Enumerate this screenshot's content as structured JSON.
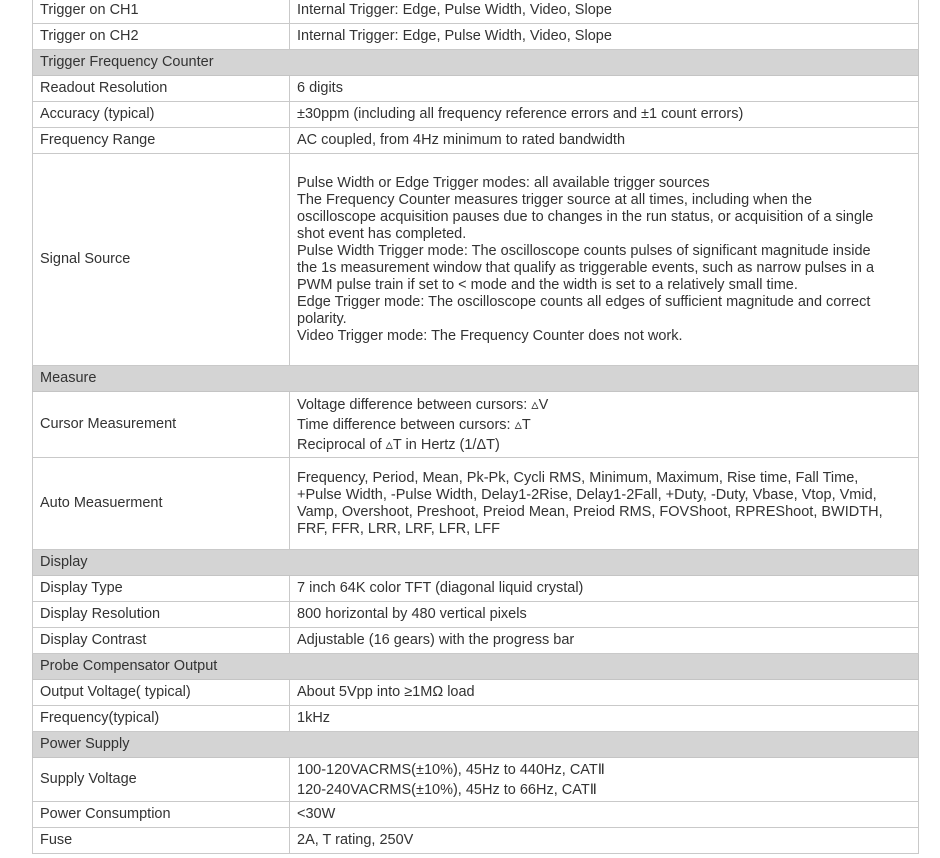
{
  "rows": [
    {
      "type": "row",
      "label": "Trigger on CH1",
      "value": [
        "Internal Trigger: Edge, Pulse Width, Video, Slope"
      ]
    },
    {
      "type": "row",
      "label": "Trigger on CH2",
      "value": [
        "Internal Trigger: Edge, Pulse Width, Video, Slope"
      ]
    },
    {
      "type": "section",
      "label": "Trigger Frequency Counter"
    },
    {
      "type": "row",
      "label": "Readout Resolution",
      "value": [
        "6 digits"
      ]
    },
    {
      "type": "row",
      "label": "Accuracy (typical)",
      "value": [
        "±30ppm (including all frequency reference errors and ±1 count errors)"
      ]
    },
    {
      "type": "row",
      "label": "Frequency Range",
      "value": [
        "AC coupled, from 4Hz minimum to rated bandwidth"
      ]
    },
    {
      "type": "row",
      "label": "Signal Source",
      "value": [
        "Pulse Width or Edge Trigger modes: all available trigger sources",
        "The Frequency Counter measures trigger source at all times, including when the",
        "oscilloscope acquisition pauses due to changes in the run status, or acquisition of a single",
        "shot event has completed.",
        "Pulse Width Trigger mode: The oscilloscope counts pulses of significant magnitude inside",
        "the 1s measurement window that qualify as triggerable events, such as narrow pulses in a",
        "PWM pulse train if set to < mode and the width is set to a relatively small time.",
        "Edge Trigger mode: The oscilloscope counts all edges of sufficient magnitude and correct",
        "polarity.",
        "Video Trigger mode: The Frequency Counter does not work."
      ]
    },
    {
      "type": "section",
      "label": "Measure"
    },
    {
      "type": "row",
      "label": "Cursor Measurement",
      "value": [
        "Voltage difference between cursors: ▵V",
        "Time difference between cursors: ▵T",
        "Reciprocal of ▵T in Hertz (1/ΔT)"
      ]
    },
    {
      "type": "row",
      "label": "Auto Measuerment",
      "value": [
        "Frequency, Period, Mean, Pk-Pk, Cycli RMS, Minimum, Maximum, Rise time, Fall Time,",
        "+Pulse Width, -Pulse Width, Delay1-2Rise, Delay1-2Fall, +Duty, -Duty, Vbase, Vtop, Vmid,",
        "Vamp, Overshoot, Preshoot, Preiod Mean, Preiod RMS, FOVShoot, RPREShoot, BWIDTH,",
        "FRF, FFR, LRR, LRF, LFR, LFF"
      ]
    },
    {
      "type": "section",
      "label": "Display"
    },
    {
      "type": "row",
      "label": "Display Type",
      "value": [
        "7 inch 64K color TFT (diagonal liquid crystal)"
      ]
    },
    {
      "type": "row",
      "label": "Display Resolution",
      "value": [
        "800 horizontal by 480 vertical pixels"
      ]
    },
    {
      "type": "row",
      "label": "Display Contrast",
      "value": [
        "Adjustable (16 gears) with the progress bar"
      ]
    },
    {
      "type": "section",
      "label": "Probe Compensator Output"
    },
    {
      "type": "row",
      "label": "Output Voltage( typical)",
      "value": [
        "About 5Vpp into ≥1MΩ load"
      ]
    },
    {
      "type": "row",
      "label": "Frequency(typical)",
      "value": [
        "1kHz"
      ]
    },
    {
      "type": "section",
      "label": "Power Supply"
    },
    {
      "type": "row",
      "label": "Supply Voltage",
      "value": [
        "100-120VACRMS(±10%), 45Hz to 440Hz, CATⅡ",
        "120-240VACRMS(±10%), 45Hz to 66Hz, CATⅡ"
      ]
    },
    {
      "type": "row",
      "label": "Power Consumption",
      "value": [
        "<30W"
      ]
    },
    {
      "type": "row",
      "label": "Fuse",
      "value": [
        "2A, T rating, 250V"
      ]
    }
  ]
}
